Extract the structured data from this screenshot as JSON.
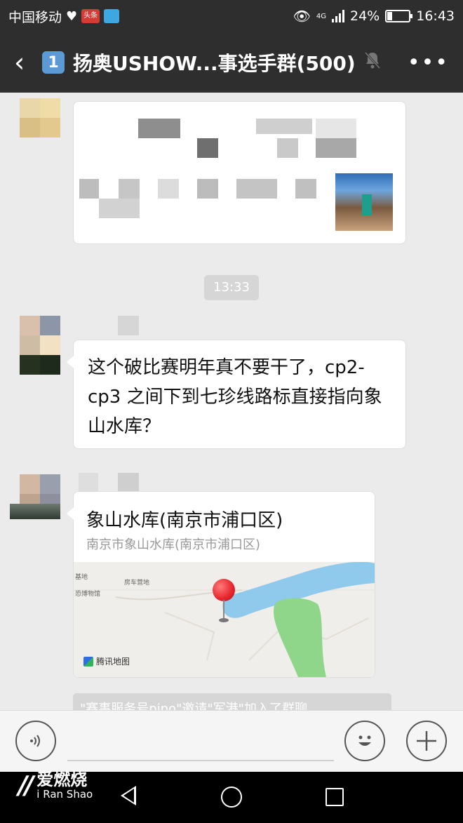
{
  "status_bar": {
    "carrier": "中国移动",
    "network": "4G",
    "battery_percent": "24%",
    "battery_level": 0.24,
    "time": "16:43",
    "toutiao_label": "头条"
  },
  "header": {
    "unread_badge": "1",
    "title": "扬奥USHOW...事选手群(500)"
  },
  "chat": {
    "timestamp": "13:33",
    "message_text": "这个破比赛明年真不要干了，cp2-cp3 之间下到七珍线路标直接指向象山水库？",
    "location": {
      "title": "象山水库(南京市浦口区)",
      "address": "南京市象山水库(南京市浦口区)",
      "map_labels": [
        "基地",
        "房车营地",
        "恐博物馆"
      ],
      "map_brand": "腾讯地图"
    },
    "system_notice": "\"赛事服务号pino\"邀请\"军港\"加入了群聊"
  },
  "watermark": {
    "cn": "爱燃烧",
    "en": "i Ran Shao"
  },
  "icons": [
    "back-icon",
    "mute-bell-icon",
    "more-icon",
    "voice-icon",
    "emoji-icon",
    "plus-icon",
    "map-pin-icon"
  ],
  "colors": {
    "topbar": "#2e2e2e",
    "chat_bg": "#ebebeb",
    "badge": "#5c9ad6",
    "map_water": "#8fc9ec",
    "map_green": "#8fd68a",
    "pin": "#e5242b"
  }
}
